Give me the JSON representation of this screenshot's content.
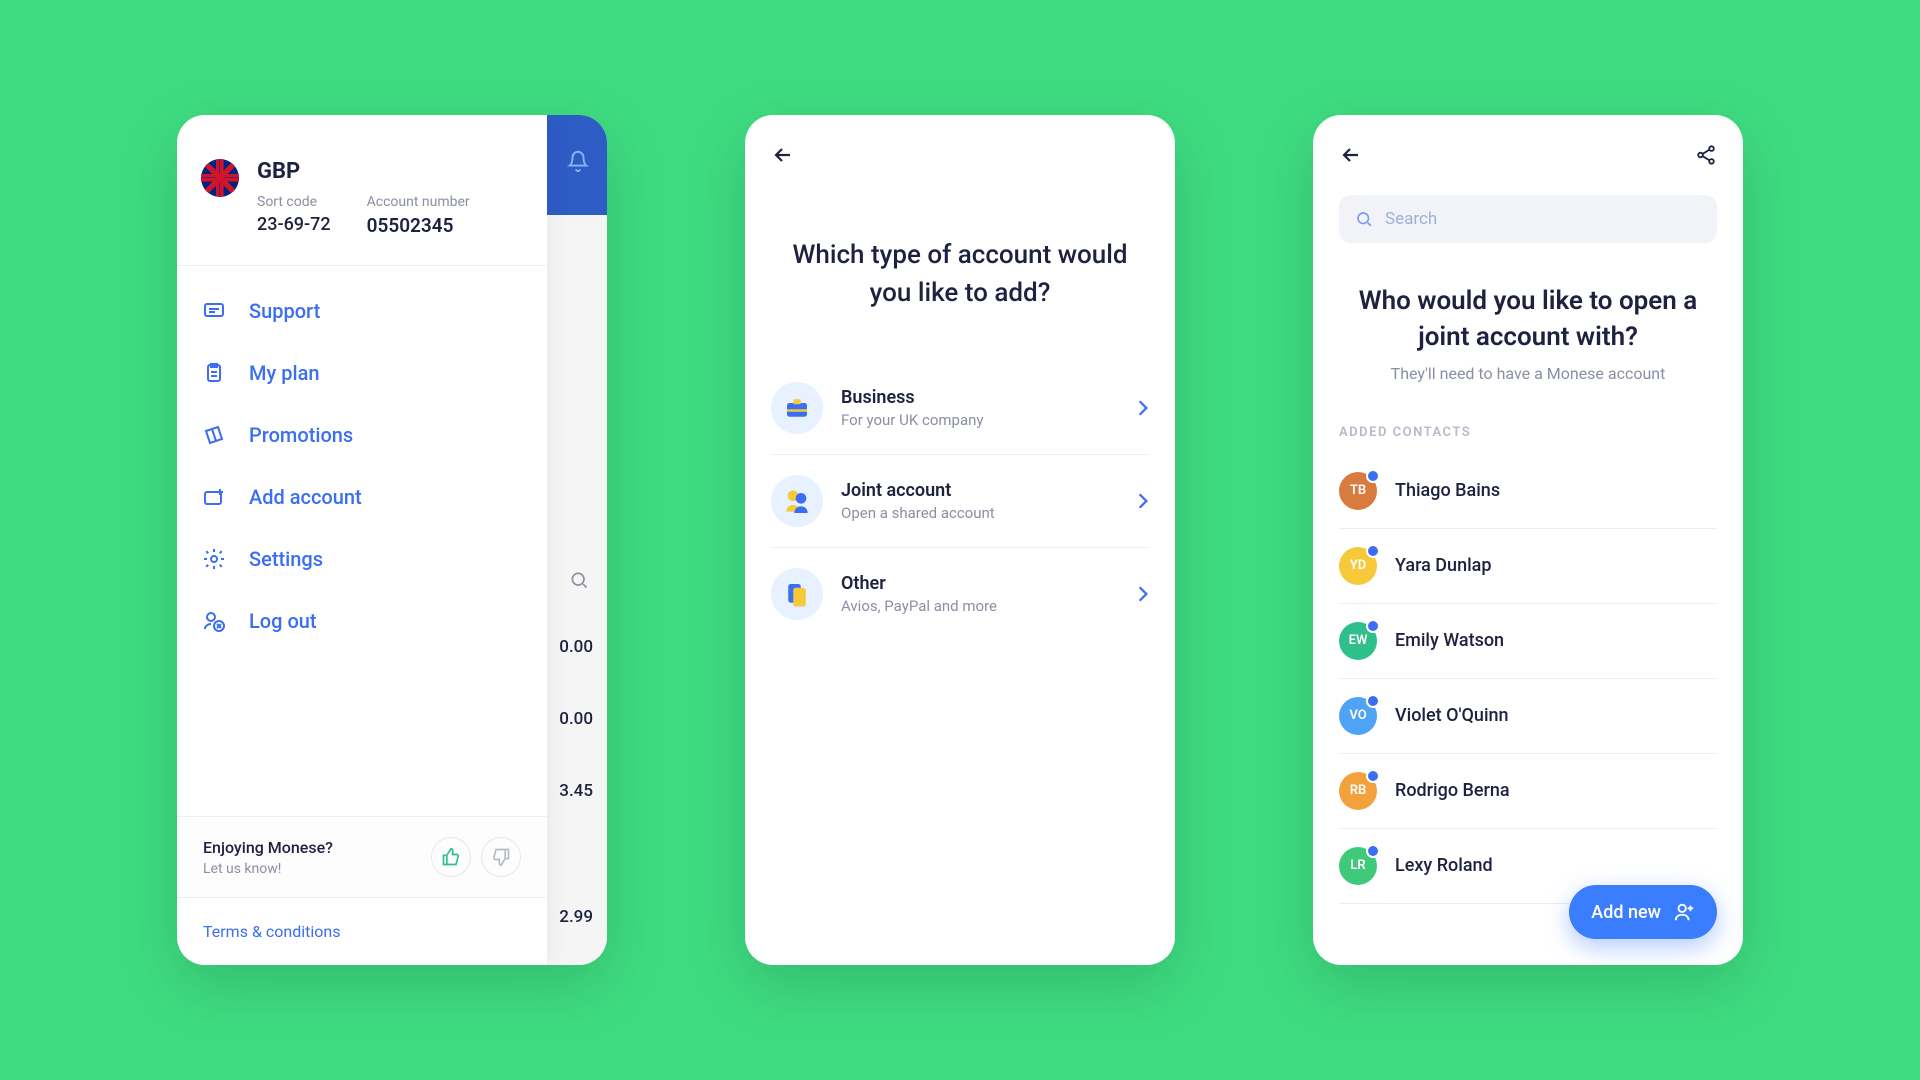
{
  "phone1": {
    "currency": "GBP",
    "sort_code_label": "Sort code",
    "sort_code": "23-69-72",
    "acct_num_label": "Account number",
    "acct_num": "05502345",
    "menu": [
      {
        "label": "Support"
      },
      {
        "label": "My plan"
      },
      {
        "label": "Promotions"
      },
      {
        "label": "Add account"
      },
      {
        "label": "Settings"
      },
      {
        "label": "Log out"
      }
    ],
    "feedback_title": "Enjoying Monese?",
    "feedback_sub": "Let us know!",
    "terms": "Terms & conditions",
    "bg_amounts": [
      "0.00",
      "0.00",
      "3.45",
      "2.99"
    ]
  },
  "phone2": {
    "title": "Which type of account would you like to add?",
    "options": [
      {
        "title": "Business",
        "sub": "For your UK company"
      },
      {
        "title": "Joint account",
        "sub": "Open a shared account"
      },
      {
        "title": "Other",
        "sub": "Avios, PayPal and more"
      }
    ]
  },
  "phone3": {
    "search_placeholder": "Search",
    "title": "Who would you like to open a joint account with?",
    "subtitle": "They'll need to have a Monese account",
    "section_label": "ADDED CONTACTS",
    "contacts": [
      {
        "initials": "TB",
        "name": "Thiago Bains",
        "color": "#D97B3E"
      },
      {
        "initials": "YD",
        "name": "Yara Dunlap",
        "color": "#F5C93A"
      },
      {
        "initials": "EW",
        "name": "Emily Watson",
        "color": "#2FBF8D"
      },
      {
        "initials": "VO",
        "name": "Violet O'Quinn",
        "color": "#4FA3F7"
      },
      {
        "initials": "RB",
        "name": "Rodrigo Berna",
        "color": "#F2A23C"
      },
      {
        "initials": "LR",
        "name": "Lexy Roland",
        "color": "#3EC97B"
      }
    ],
    "fab_label": "Add new"
  }
}
